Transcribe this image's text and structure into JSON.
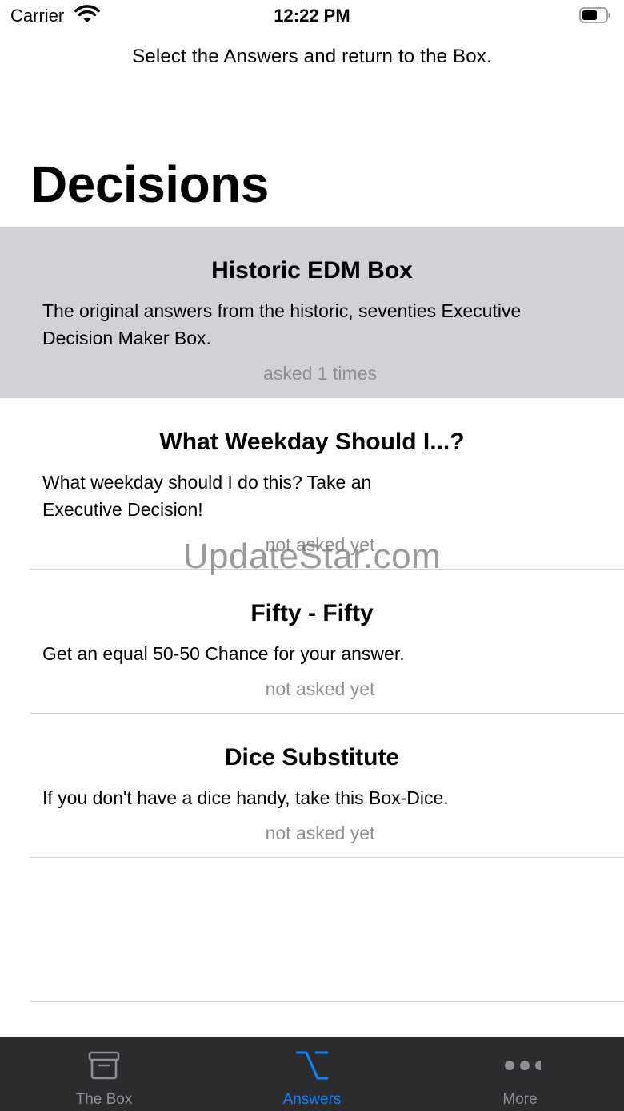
{
  "status_bar": {
    "carrier": "Carrier",
    "time": "12:22 PM"
  },
  "header": {
    "instruction": "Select the Answers and return to the Box.",
    "title": "Decisions"
  },
  "decisions": [
    {
      "title": "Historic EDM Box",
      "description": "The original answers from the historic, seventies Executive Decision Maker Box.",
      "count": "asked 1 times",
      "selected": true
    },
    {
      "title": "What Weekday Should I...?",
      "description": "What weekday should I do this? Take an Executive Decision!",
      "count": "not asked yet",
      "selected": false
    },
    {
      "title": "Fifty - Fifty",
      "description": "Get an equal 50-50 Chance for your answer.",
      "count": "not asked yet",
      "selected": false
    },
    {
      "title": "Dice Substitute",
      "description": "If you don't have a dice handy, take this Box-Dice.",
      "count": "not asked yet",
      "selected": false
    }
  ],
  "watermark": "UpdateStar.com",
  "tab_bar": {
    "tabs": [
      {
        "label": "The Box",
        "icon": "archive-box-icon",
        "active": false
      },
      {
        "label": "Answers",
        "icon": "option-key-icon",
        "active": true
      },
      {
        "label": "More",
        "icon": "more-dots-icon",
        "active": false
      }
    ]
  },
  "colors": {
    "selected_row": "#d1d1d6",
    "tab_bar_bg": "#2c2c2e",
    "tab_active": "#0a84ff",
    "tab_inactive": "#8e8e93",
    "secondary_text": "#8e8e93"
  }
}
